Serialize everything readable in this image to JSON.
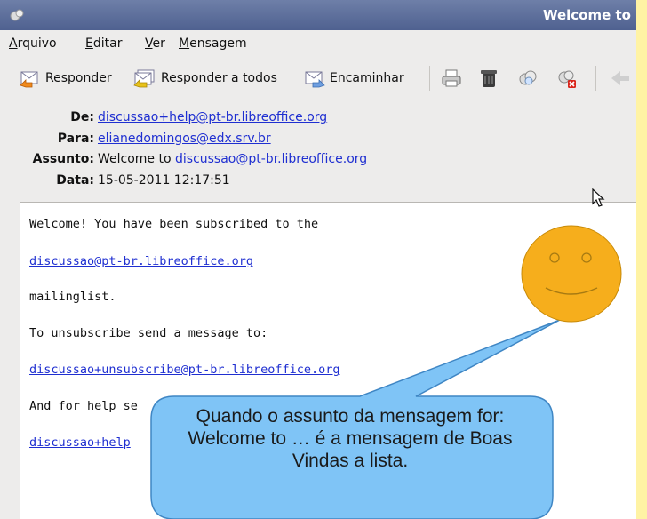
{
  "window": {
    "title": "Welcome to"
  },
  "menu": [
    "Arquivo",
    "Editar",
    "Ver",
    "Mensagem"
  ],
  "toolbar": {
    "reply_label": "Responder",
    "reply_all_label": "Responder a todos",
    "forward_label": "Encaminhar"
  },
  "headers": {
    "from_label": "De:",
    "from_value": "discussao+help@pt-br.libreoffice.org",
    "to_label": "Para:",
    "to_value": "elianedomingos@edx.srv.br",
    "subject_label": "Assunto:",
    "subject_prefix": "Welcome to ",
    "subject_link": "discussao@pt-br.libreoffice.org",
    "date_label": "Data:",
    "date_value": "15-05-2011 12:17:51"
  },
  "body": {
    "line1": "Welcome! You have been subscribed to the",
    "line2": "discussao@pt-br.libreoffice.org",
    "line3": "mailinglist.",
    "line4": "To unsubscribe send a message to:",
    "line5": "discussao+unsubscribe@pt-br.libreoffice.org",
    "line6": "And for help se",
    "line7": "discussao+help"
  },
  "callout": {
    "text": "Quando o assunto da mensagem for: Welcome to … é a mensagem de Boas Vindas a lista."
  },
  "colors": {
    "titlebar": "#5a6b99",
    "link": "#1f2fd1",
    "callout_fill": "#7fc4f6",
    "smiley_fill": "#f6ae1c"
  }
}
